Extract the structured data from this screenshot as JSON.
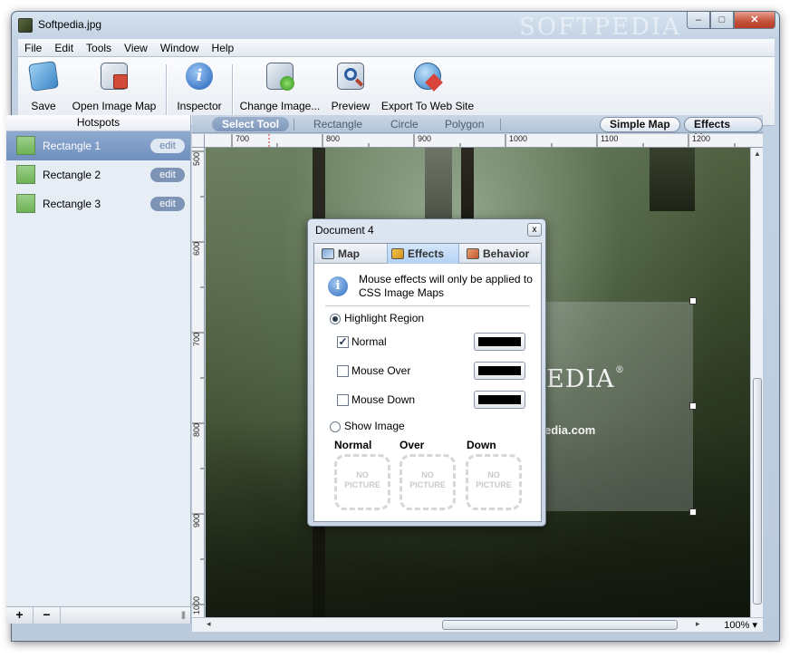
{
  "window": {
    "title": "Softpedia.jpg",
    "watermark": "SOFTPEDIA"
  },
  "controls": {
    "minimize": "–",
    "maximize": "□",
    "close": "✕"
  },
  "menu": [
    "File",
    "Edit",
    "Tools",
    "View",
    "Window",
    "Help"
  ],
  "toolbar": {
    "save": "Save",
    "open_image_map": "Open Image Map",
    "inspector": "Inspector",
    "change_image": "Change Image...",
    "preview": "Preview",
    "export": "Export To Web Site"
  },
  "hotspots": {
    "header": "Hotspots",
    "items": [
      {
        "label": "Rectangle 1",
        "edit": "edit",
        "selected": true
      },
      {
        "label": "Rectangle 2",
        "edit": "edit",
        "selected": false
      },
      {
        "label": "Rectangle 3",
        "edit": "edit",
        "selected": false
      }
    ],
    "add": "+",
    "remove": "−",
    "grip": "|||"
  },
  "tools": {
    "select": "Select Tool",
    "rectangle": "Rectangle",
    "circle": "Circle",
    "polygon": "Polygon",
    "simple_map": "Simple Map",
    "effects_map": "Effects Map"
  },
  "ruler": {
    "h": [
      "700",
      "800",
      "900",
      "1000",
      "1100",
      "1200"
    ],
    "v": [
      "500",
      "600",
      "700",
      "800",
      "900",
      "1000"
    ]
  },
  "canvas_text": {
    "brand": "EDIA",
    "registered": "®",
    "url": "edia.com"
  },
  "zoom": "100%",
  "panel": {
    "title": "Document 4",
    "close": "x",
    "tabs": {
      "map": "Map",
      "effects": "Effects",
      "behavior": "Behavior"
    },
    "info": "Mouse effects will only be applied to CSS Image Maps",
    "highlight_region": "Highlight Region",
    "normal": "Normal",
    "mouse_over": "Mouse Over",
    "mouse_down": "Mouse Down",
    "show_image": "Show Image",
    "col_normal": "Normal",
    "col_over": "Over",
    "col_down": "Down",
    "no_picture_1": "NO",
    "no_picture_2": "PICTURE",
    "normal_checked": true,
    "highlight_selected": true,
    "color_normal": "#000000",
    "color_over": "#000000",
    "color_down": "#000000"
  }
}
